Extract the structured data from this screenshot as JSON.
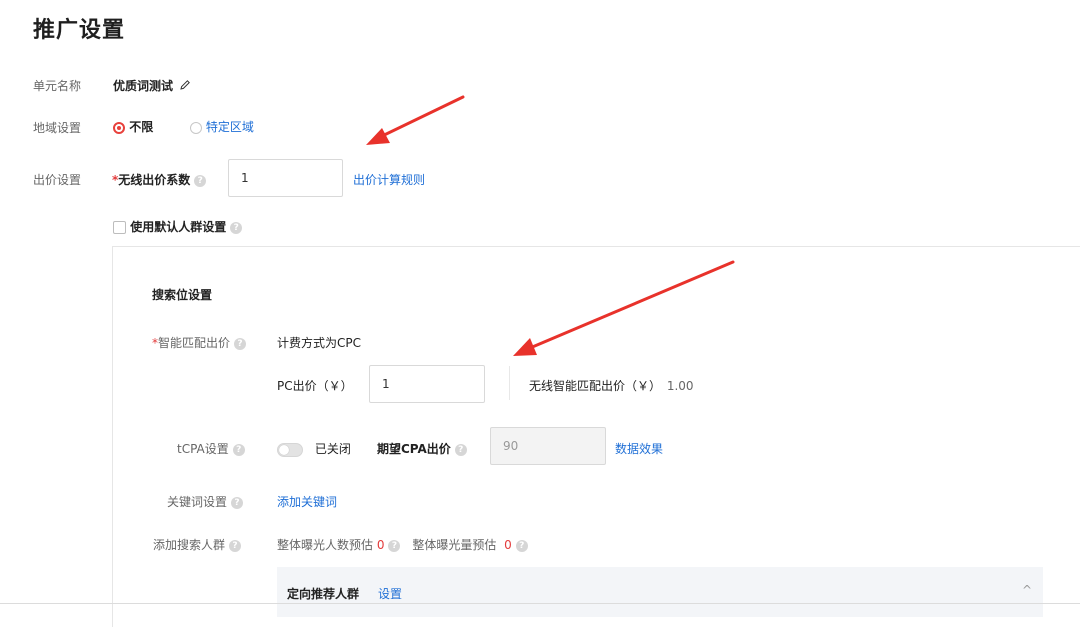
{
  "page": {
    "title": "推广设置"
  },
  "unit": {
    "label": "单元名称",
    "value": "优质词测试"
  },
  "region": {
    "label": "地域设置",
    "options": [
      "不限",
      "特定区域"
    ],
    "selected": "不限"
  },
  "bid": {
    "label": "出价设置",
    "required_mark": "*",
    "wireless_label": "无线出价系数",
    "wireless_value": "1",
    "rule_link": "出价计算规则"
  },
  "default_crowd": {
    "label": "使用默认人群设置",
    "checked": false
  },
  "search_section": {
    "title": "搜索位设置",
    "smart_bid": {
      "required_mark": "*",
      "label": "智能匹配出价",
      "billing": "计费方式为CPC",
      "pc_label": "PC出价（￥）",
      "pc_value": "1",
      "wireless_label": "无线智能匹配出价（￥）",
      "wireless_value": "1.00"
    },
    "tcpa": {
      "label": "tCPA设置",
      "status": "已关闭",
      "expected_label": "期望CPA出价",
      "expected_value": "90",
      "data_link": "数据效果"
    },
    "keywords": {
      "label": "关键词设置",
      "link": "添加关键词"
    },
    "crowd": {
      "label": "添加搜索人群",
      "people_label": "整体曝光人数预估",
      "people_value": "0",
      "volume_label": "整体曝光量预估",
      "volume_value": "0"
    },
    "recommend": {
      "title": "定向推荐人群",
      "link": "设置",
      "chevron": "^"
    }
  },
  "colors": {
    "accent": "#e8413c",
    "link": "#1f6fd6",
    "arrow": "#e8322b"
  },
  "icons": [
    "pencil-icon",
    "help-icon",
    "chevron-up-icon",
    "arrow-annotation"
  ]
}
